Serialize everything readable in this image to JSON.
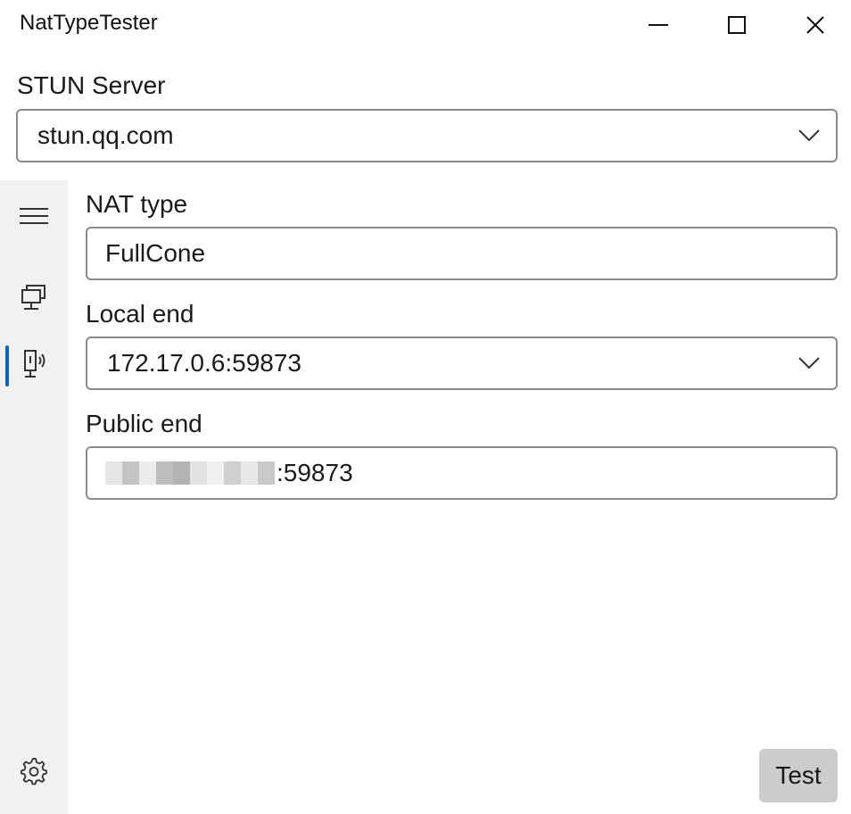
{
  "window": {
    "title": "NatTypeTester",
    "controls": {
      "minimize_icon": "minimize-icon",
      "maximize_icon": "maximize-icon",
      "close_icon": "close-icon"
    }
  },
  "stun": {
    "label": "STUN Server",
    "value": "stun.qq.com"
  },
  "sidebar": {
    "items": [
      {
        "name": "menu",
        "icon": "hamburger-icon",
        "selected": false
      },
      {
        "name": "server",
        "icon": "network-computer-icon",
        "selected": false
      },
      {
        "name": "nat",
        "icon": "device-signal-icon",
        "selected": true
      },
      {
        "name": "settings",
        "icon": "gear-icon",
        "selected": false
      }
    ],
    "accent_color": "#0a63c6"
  },
  "form": {
    "nat_type": {
      "label": "NAT type",
      "value": "FullCone"
    },
    "local_end": {
      "label": "Local end",
      "value": "172.17.0.6:59873"
    },
    "public_end": {
      "label": "Public end",
      "value_visible": ":59873"
    }
  },
  "actions": {
    "test_label": "Test"
  }
}
